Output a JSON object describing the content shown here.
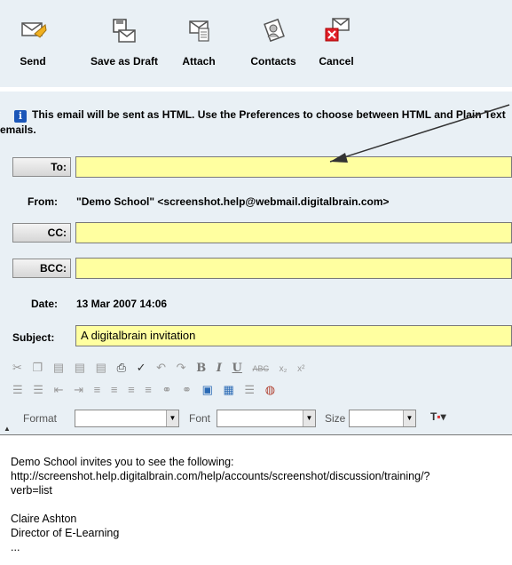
{
  "toolbar": {
    "send_label": "Send",
    "save_draft_label": "Save as Draft",
    "attach_label": "Attach",
    "contacts_label": "Contacts",
    "cancel_label": "Cancel"
  },
  "info": {
    "icon": "i",
    "message": "This email will be sent as HTML. Use the Preferences to choose between HTML and Plain Text emails."
  },
  "fields": {
    "to_label": "To:",
    "to_value": "",
    "from_label": "From:",
    "from_value": "\"Demo School\" <screenshot.help@webmail.digitalbrain.com>",
    "cc_label": "CC:",
    "cc_value": "",
    "bcc_label": "BCC:",
    "bcc_value": "",
    "date_label": "Date:",
    "date_value": "13 Mar 2007 14:06",
    "subject_label": "Subject:",
    "subject_value": "A digitalbrain invitation"
  },
  "editor": {
    "format_label": "Format",
    "font_label": "Font",
    "size_label": "Size",
    "bold": "B",
    "italic": "I",
    "underline": "U",
    "strike": "ABC"
  },
  "message": {
    "line1": "Demo School invites you to see the following:",
    "line2": "http://screenshot.help.digitalbrain.com/help/accounts/screenshot/discussion/training/?",
    "line3": "verb=list",
    "line4": "Claire Ashton",
    "line5": "Director of E-Learning",
    "line6": "..."
  },
  "colors": {
    "panel": "#e9f0f5",
    "field_yellow": "#ffffa0",
    "arrow": "#333333",
    "cancel_red": "#e0202a"
  }
}
